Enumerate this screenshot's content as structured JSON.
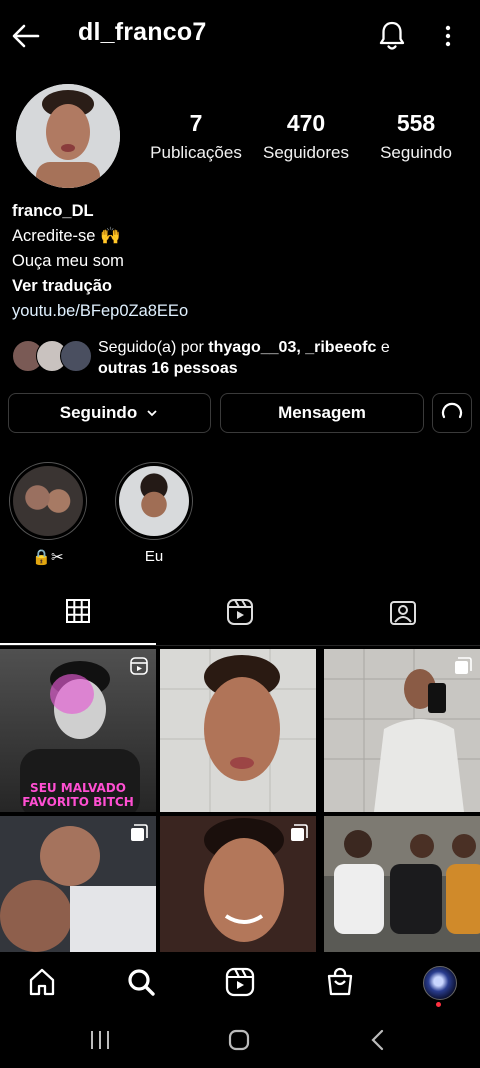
{
  "header": {
    "username": "dl_franco7"
  },
  "profile": {
    "stats": [
      {
        "value": "7",
        "label": "Publicações"
      },
      {
        "value": "470",
        "label": "Seguidores"
      },
      {
        "value": "558",
        "label": "Seguindo"
      }
    ],
    "name": "franco_DL",
    "bio_line1": "Acredite-se 🙌",
    "bio_line2": "Ouça meu som",
    "translate": "Ver tradução",
    "link": "youtu.be/BFep0Za8EEo",
    "followed_by_prefix": "Seguido(a) por ",
    "followed_by_users": "thyago__03, _ribeeofc",
    "followed_by_mid": " e",
    "followed_by_others": "outras 16 pessoas"
  },
  "buttons": {
    "following": "Seguindo",
    "message": "Mensagem"
  },
  "highlights": [
    {
      "label": "🔒✂"
    },
    {
      "label": "Eu"
    }
  ],
  "grid": {
    "tile1_caption_line1": "SEU MALVADO",
    "tile1_caption_line2": "FAVORITO BITCH"
  },
  "colors": {
    "background": "#000000",
    "text": "#ffffff",
    "border": "#3a3a3a",
    "notification_dot": "#ff3040"
  },
  "icons": [
    "back-arrow-icon",
    "bell-icon",
    "more-vert-icon",
    "grid-icon",
    "reels-icon",
    "tagged-icon",
    "home-icon",
    "search-icon",
    "reels-nav-icon",
    "shop-icon",
    "profile-avatar-icon"
  ]
}
